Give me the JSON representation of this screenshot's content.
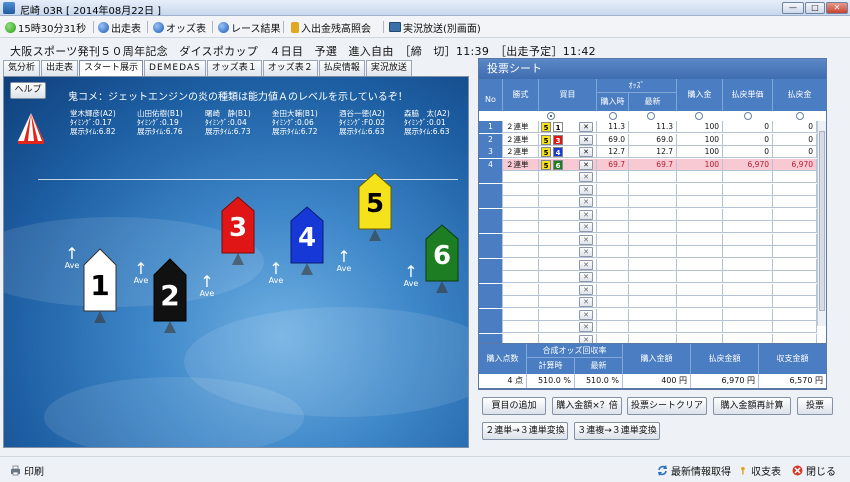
{
  "window": {
    "title": "尼崎 03R [ 2014年08月22日 ]",
    "min": "—",
    "max": "□",
    "close": "✕"
  },
  "toolbar": {
    "clock": "15時30分31秒",
    "items": [
      "出走表",
      "オッズ表",
      "レース結果",
      "入出金残高照会",
      "実況放送(別画面)"
    ]
  },
  "race": {
    "header": "大阪スポーツ発刊５０周年記念　ダイスポカップ　４日目　予選　進入自由　［締　切］11:39　［出走予定］11:42"
  },
  "tabs": [
    "気分析",
    "出走表",
    "スタート展示",
    "DEMEDAS",
    "オッズ表１",
    "オッズ表２",
    "払戻情報",
    "実況放送"
  ],
  "stage": {
    "help": "ヘルプ",
    "comment": "鬼コメ：ジェットエンジンの炎の種類は能力値Ａのレベルを示しているぞ！",
    "racers": [
      {
        "name": "堂木輝彦(A2)",
        "timing": "ﾀｲﾐﾝｸﾞ:0.17",
        "tenji": "展示ﾀｲﾑ:6.82"
      },
      {
        "name": "山田佑樹(B1)",
        "timing": "ﾀｲﾐﾝｸﾞ:0.19",
        "tenji": "展示ﾀｲﾑ:6.76"
      },
      {
        "name": "曙崎　静(B1)",
        "timing": "ﾀｲﾐﾝｸﾞ:0.04",
        "tenji": "展示ﾀｲﾑ:6.73"
      },
      {
        "name": "金田大輔(B1)",
        "timing": "ﾀｲﾐﾝｸﾞ:0.06",
        "tenji": "展示ﾀｲﾑ:6.72"
      },
      {
        "name": "酒谷一徳(A2)",
        "timing": "ﾀｲﾐﾝｸﾞ:F0.02",
        "tenji": "展示ﾀｲﾑ:6.63"
      },
      {
        "name": "森脇　太(A2)",
        "timing": "ﾀｲﾐﾝｸﾞ:0.01",
        "tenji": "展示ﾀｲﾑ:6.63"
      }
    ],
    "ave": "Ave",
    "boats": [
      {
        "num": "1",
        "color": "#ffffff",
        "text": "#000000"
      },
      {
        "num": "2",
        "color": "#111111",
        "text": "#ffffff"
      },
      {
        "num": "3",
        "color": "#e01515",
        "text": "#ffffff"
      },
      {
        "num": "4",
        "color": "#1538d6",
        "text": "#ffffff"
      },
      {
        "num": "5",
        "color": "#f5e21a",
        "text": "#000000"
      },
      {
        "num": "6",
        "color": "#1c7d22",
        "text": "#ffffff"
      }
    ]
  },
  "sheet": {
    "title": "投票シート",
    "headers": {
      "no": "No",
      "shiki": "勝式",
      "kaime": "買目",
      "odds": "ｵｯｽﾞ",
      "kounyuji": "購入時",
      "saishin": "最新",
      "kounyukin": "購入金",
      "haraimodoshi_tanka": "払戻単価",
      "haraimodoshi_kin": "払戻金"
    },
    "del_label": "✕",
    "rows": [
      {
        "no": "1",
        "shiki": "２連単",
        "k1": "5",
        "k2": "1",
        "o1": "11.3",
        "o2": "11.3",
        "kin": "100",
        "tanka": "0",
        "harai": "0",
        "hl": false
      },
      {
        "no": "2",
        "shiki": "２連単",
        "k1": "5",
        "k2": "3",
        "o1": "69.0",
        "o2": "69.0",
        "kin": "100",
        "tanka": "0",
        "harai": "0",
        "hl": false
      },
      {
        "no": "3",
        "shiki": "２連単",
        "k1": "5",
        "k2": "4",
        "o1": "12.7",
        "o2": "12.7",
        "kin": "100",
        "tanka": "0",
        "harai": "0",
        "hl": false
      },
      {
        "no": "4",
        "shiki": "２連単",
        "k1": "5",
        "k2": "6",
        "o1": "69.7",
        "o2": "69.7",
        "kin": "100",
        "tanka": "6,970",
        "harai": "6,970",
        "hl": true
      }
    ],
    "empty_rows": 16
  },
  "totals": {
    "headers": {
      "points": "購入点数",
      "goudou": "合成オッズ回収率",
      "keisanji": "計算時",
      "saishin": "最新",
      "kounyu": "購入金額",
      "harai": "払戻金額",
      "shushi": "収支金額"
    },
    "points": "4 点",
    "keisanji": "510.0 %",
    "saishin": "510.0 %",
    "kounyu": "400 円",
    "harai": "6,970 円",
    "shushi": "6,570 円"
  },
  "buttons": {
    "add": "買目の追加",
    "multiply": "購入金額×？倍",
    "clear": "投票シートクリア",
    "recalc": "購入金額再計算",
    "vote": "投票",
    "conv2to3": "２連単→３連単変換",
    "conv3to3": "３連複→３連単変換"
  },
  "footer": {
    "print": "印刷",
    "refresh": "最新情報取得",
    "balance": "収支表",
    "close": "閉じる"
  }
}
